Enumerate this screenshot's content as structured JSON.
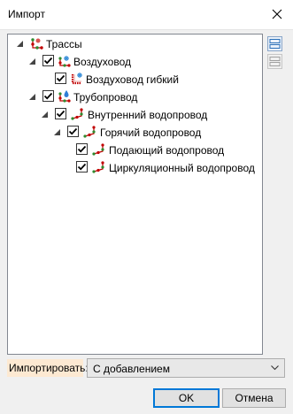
{
  "window": {
    "title": "Импорт"
  },
  "tree": {
    "nodes": [
      {
        "label": "Трассы",
        "icon": "route-icon",
        "checkbox": false,
        "expander": true
      },
      {
        "label": "Воздуховод",
        "icon": "air-duct-icon",
        "checkbox": true,
        "checked": true,
        "expander": true
      },
      {
        "label": "Воздуховод гибкий",
        "icon": "flexible-duct-icon",
        "checkbox": true,
        "checked": true,
        "expander": false
      },
      {
        "label": "Трубопровод",
        "icon": "pipeline-icon",
        "checkbox": true,
        "checked": true,
        "expander": true
      },
      {
        "label": "Внутренний водопровод",
        "icon": "route-icon",
        "checkbox": true,
        "checked": true,
        "expander": true
      },
      {
        "label": "Горячий водопровод",
        "icon": "route-icon",
        "checkbox": true,
        "checked": true,
        "expander": true
      },
      {
        "label": "Подающий водопровод",
        "icon": "route-icon",
        "checkbox": true,
        "checked": true,
        "expander": false
      },
      {
        "label": "Циркуляционный водопровод",
        "icon": "route-icon",
        "checkbox": true,
        "checked": true,
        "expander": false
      }
    ]
  },
  "import_mode": {
    "label": "Импортировать:",
    "value": "С добавлением"
  },
  "buttons": {
    "ok": "OK",
    "cancel": "Отмена"
  },
  "colors": {
    "accent": "#0078d7",
    "label_bg": "#fde9d2",
    "route_red": "#c00000",
    "route_green": "#2e8b2e"
  }
}
